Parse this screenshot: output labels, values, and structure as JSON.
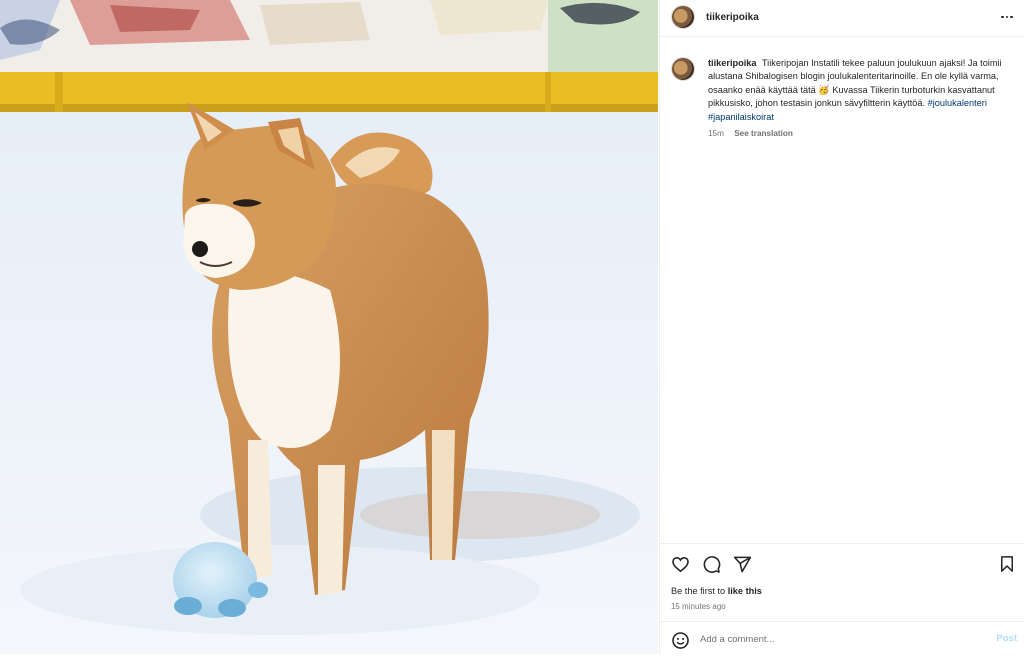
{
  "post": {
    "username": "tiikeripoika",
    "more_icon": "more-horizontal-icon"
  },
  "caption": {
    "username": "tiikeripoika",
    "text": "Tiikeripojan Instatili tekee paluun joulukuun ajaksi! Ja toimii alustana Shibalogisen blogin joulukalenteritarinoille. En ole kyllä varma, osaanko enää käyttää tätä 🥳 Kuvassa Tiikerin turboturkin kasvattanut pikkusisko, johon testasin jonkun sävyfiltterin käyttöä.",
    "hashtags": [
      "#joulukalenteri",
      "#japanilaiskoirat"
    ],
    "age": "15m",
    "translate_label": "See translation"
  },
  "actions": {
    "like_icon": "heart-icon",
    "comment_icon": "comment-icon",
    "share_icon": "share-icon",
    "save_icon": "bookmark-icon",
    "likes_prefix": "Be the first to",
    "likes_action": "like this",
    "timestamp": "15 minutes ago"
  },
  "comment": {
    "emoji_icon": "smiley-icon",
    "placeholder": "Add a comment...",
    "post_label": "Post"
  },
  "colors": {
    "link": "#00376b",
    "post_disabled": "#b3dbff",
    "muted": "#737373"
  }
}
